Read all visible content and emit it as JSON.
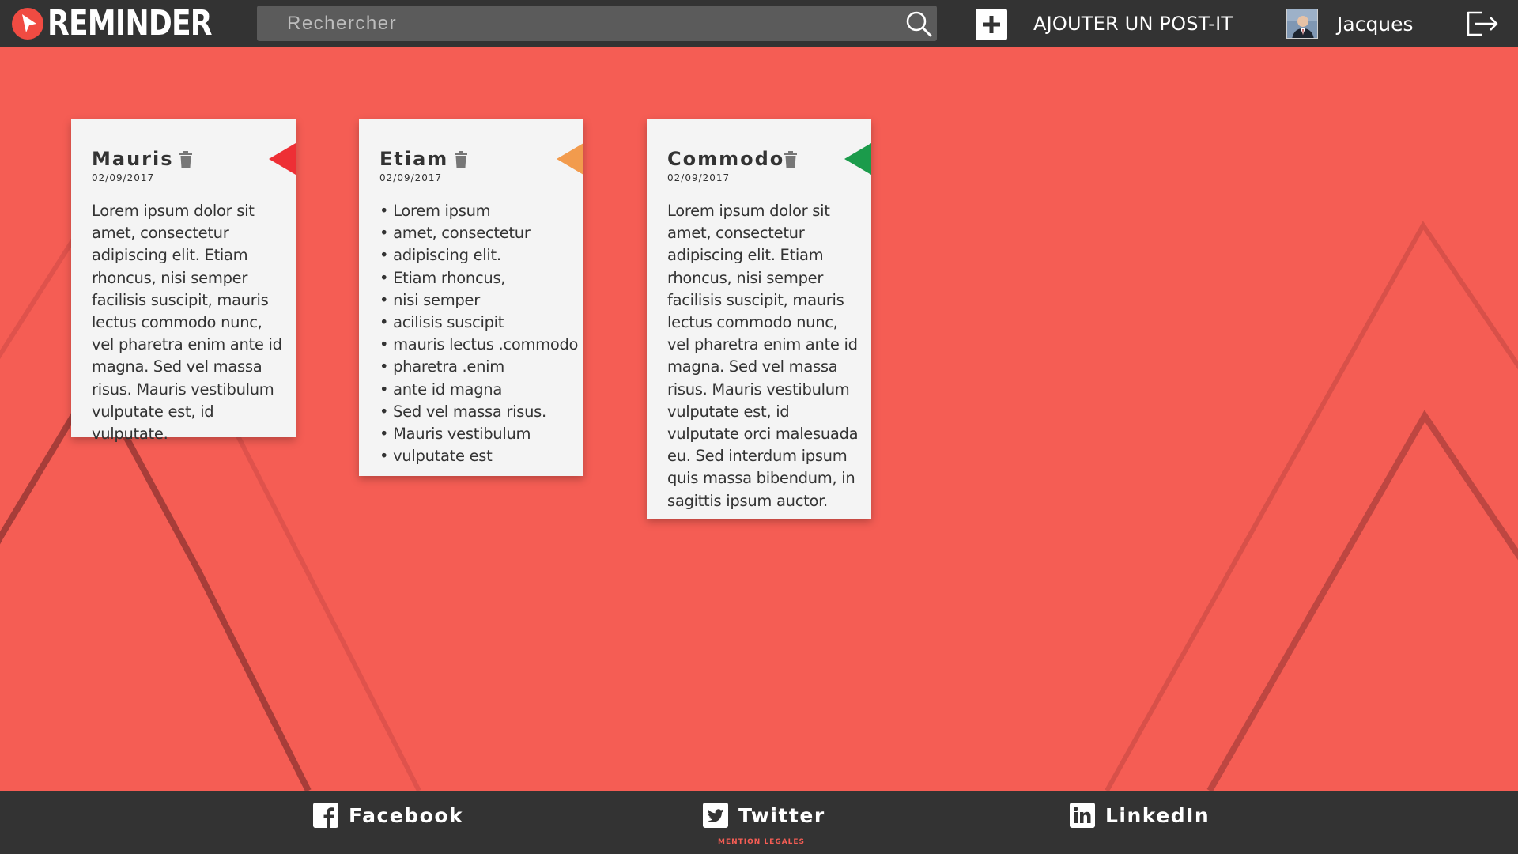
{
  "app": {
    "brand": "REMINDER"
  },
  "header": {
    "search_placeholder": "Rechercher",
    "add_label": "AJOUTER UN POST-IT",
    "user_name": "Jacques"
  },
  "colors": {
    "background": "#f55d54",
    "bar": "#333333",
    "flag_red": "#ee2f35",
    "flag_orange": "#f29b4d",
    "flag_green": "#1b9b4b"
  },
  "notes": [
    {
      "title": "Mauris",
      "date": "02/09/2017",
      "flag_color": "red",
      "body": "Lorem ipsum dolor sit amet, consectetur adipiscing elit. Etiam rhoncus, nisi semper facilisis suscipit, mauris lectus commodo nunc, vel pharetra enim ante id magna. Sed vel massa risus. Mauris vestibulum vulputate est, id vulputate."
    },
    {
      "title": "Etiam",
      "date": "02/09/2017",
      "flag_color": "orange",
      "items": [
        "Lorem ipsum",
        "amet, consectetur",
        "adipiscing elit.",
        "Etiam rhoncus,",
        "nisi semper",
        "acilisis suscipit",
        "mauris lectus .commodo",
        "pharetra .enim",
        "ante id magna",
        "Sed vel massa risus.",
        "Mauris vestibulum",
        "vulputate est"
      ]
    },
    {
      "title": "Commodo",
      "date": "02/09/2017",
      "flag_color": "green",
      "body": "Lorem ipsum dolor sit amet, consectetur adipiscing elit. Etiam rhoncus, nisi semper facilisis suscipit, mauris lectus commodo nunc, vel pharetra enim ante id magna. Sed vel massa risus. Mauris vestibulum vulputate est, id vulputate orci malesuada eu. Sed interdum ipsum quis massa bibendum, in sagittis ipsum auctor."
    }
  ],
  "footer": {
    "facebook": "Facebook",
    "twitter": "Twitter",
    "linkedin": "LinkedIn",
    "legal": "MENTION LEGALES"
  },
  "icons": {
    "logo": "play-cursor-icon",
    "search": "search-icon",
    "add": "plus-icon",
    "logout": "logout-icon",
    "delete": "trash-icon",
    "flag": "triangle-flag-icon"
  }
}
